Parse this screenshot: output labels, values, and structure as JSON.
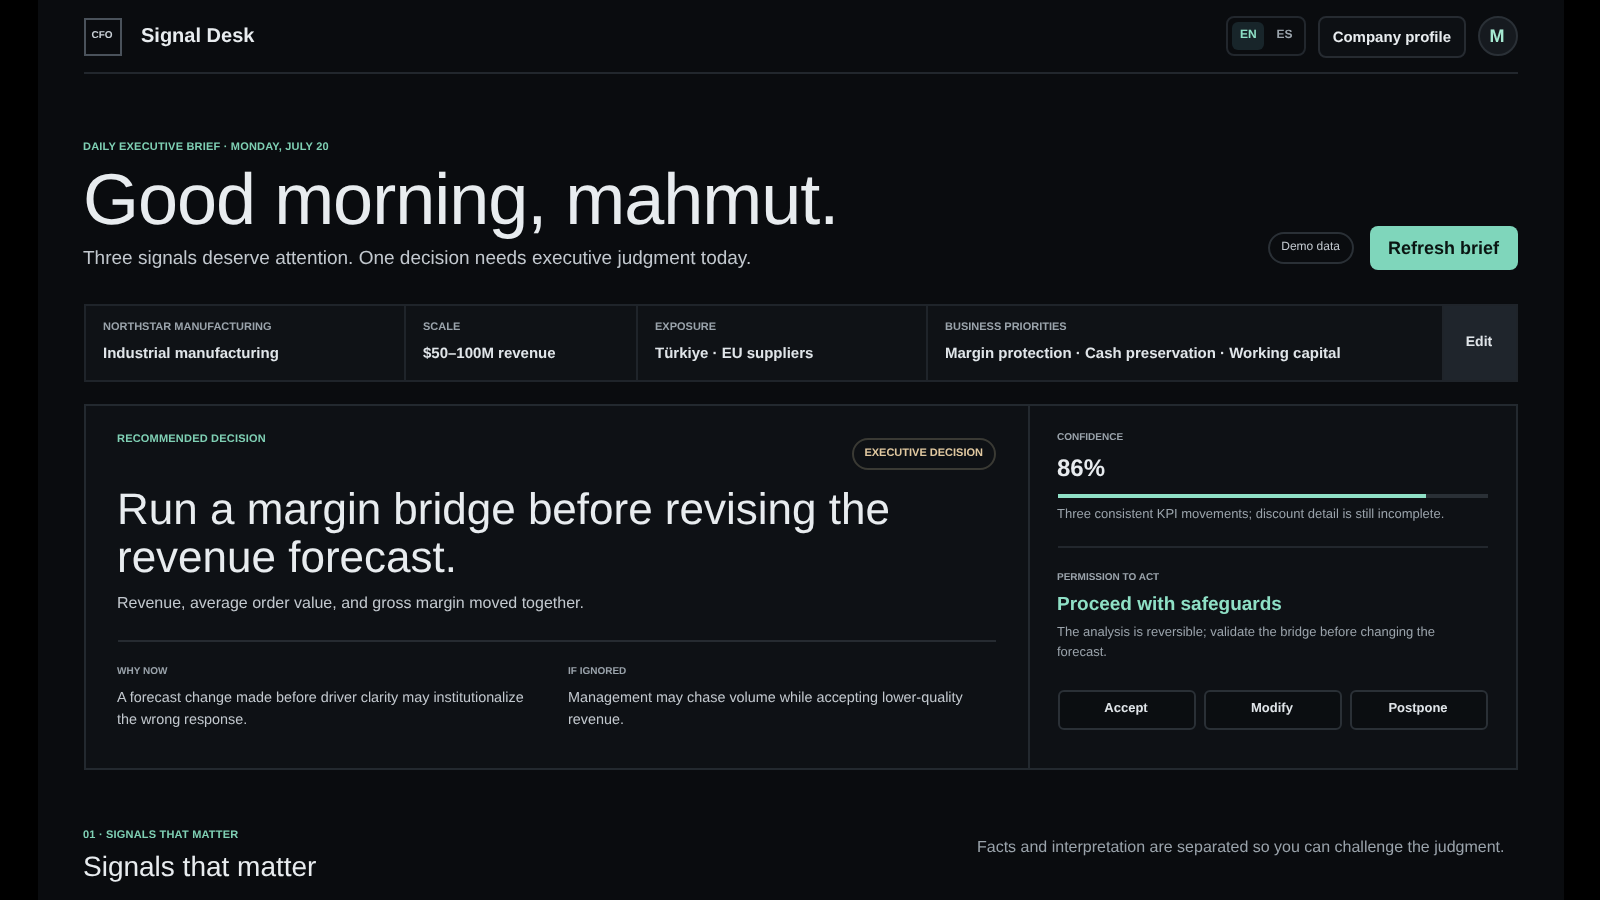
{
  "header": {
    "logo": "CFO",
    "title": "Signal Desk",
    "languages": [
      {
        "label": "EN",
        "selected": true
      },
      {
        "label": "ES",
        "selected": false
      }
    ],
    "profile_button": "Company profile",
    "avatar": "M"
  },
  "brief": {
    "eyebrow": "DAILY EXECUTIVE BRIEF · MONDAY, JULY 20",
    "greeting": "Good morning, mahmut.",
    "subtitle": "Three signals deserve attention. One decision needs executive judgment today.",
    "demo_badge": "Demo data",
    "refresh_button": "Refresh brief"
  },
  "company": {
    "fields": [
      {
        "label": "NORTHSTAR MANUFACTURING",
        "value": "Industrial manufacturing"
      },
      {
        "label": "SCALE",
        "value": "$50–100M revenue"
      },
      {
        "label": "EXPOSURE",
        "value": "Türkiye · EU suppliers"
      },
      {
        "label": "BUSINESS PRIORITIES",
        "value": "Margin protection · Cash preservation · Working capital"
      }
    ],
    "edit_button": "Edit"
  },
  "decision": {
    "eyebrow": "RECOMMENDED DECISION",
    "badge": "EXECUTIVE DECISION",
    "headline": "Run a margin bridge before revising the revenue forecast.",
    "summary": "Revenue, average order value, and gross margin moved together.",
    "notes": [
      {
        "label": "WHY NOW",
        "text": "A forecast change made before driver clarity may institutionalize the wrong response."
      },
      {
        "label": "IF IGNORED",
        "text": "Management may chase volume while accepting lower-quality revenue."
      }
    ],
    "confidence": {
      "label": "CONFIDENCE",
      "value": "86%",
      "level": 0.86,
      "note": "Three consistent KPI movements; discount detail is still incomplete."
    },
    "permission": {
      "label": "PERMISSION TO ACT",
      "value": "Proceed with safeguards",
      "note": "The analysis is reversible; validate the bridge before changing the forecast."
    },
    "actions": [
      "Accept",
      "Modify",
      "Postpone"
    ]
  },
  "section": {
    "eyebrow": "01 · SIGNALS THAT MATTER",
    "title": "Signals that matter",
    "note": "Facts and interpretation are separated so you can challenge the judgment."
  }
}
